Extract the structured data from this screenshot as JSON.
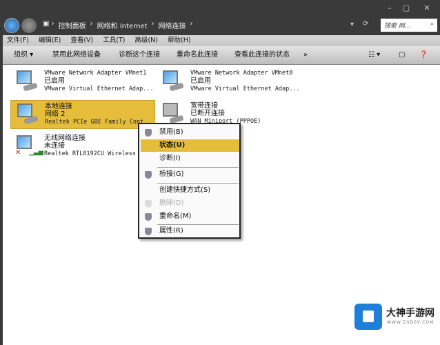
{
  "window": {
    "minimize": "–",
    "maximize": "▢",
    "close": "✕"
  },
  "address": {
    "breadcrumbs": [
      "控制面板",
      "网络和 Internet",
      "网络连接"
    ],
    "search_placeholder": "搜索 网..."
  },
  "menu": [
    "文件(F)",
    "编辑(E)",
    "查看(V)",
    "工具(T)",
    "高级(N)",
    "帮助(H)"
  ],
  "toolbar": {
    "organize": "组织 ▾",
    "disable": "禁用此网络设备",
    "diagnose": "诊断这个连接",
    "rename": "重命名此连接",
    "status": "查看此连接的状态",
    "more": "»"
  },
  "connections": [
    {
      "name": "VMware Network Adapter VMnet1",
      "status": "已启用",
      "device": "VMware Virtual Ethernet Adap..."
    },
    {
      "name": "VMware Network Adapter VMnet8",
      "status": "已启用",
      "device": "VMware Virtual Ethernet Adap..."
    },
    {
      "name": "本地连接",
      "status": "网络  2",
      "device": "Realtek PCIe GBE Family Cont",
      "selected": true
    },
    {
      "name": "宽带连接",
      "status": "已断开连接",
      "device": "WAN Miniport (PPPOE)"
    },
    {
      "name": "无线网络连接",
      "status": "未连接",
      "device": "Realtek RTL8192CU Wireless L"
    }
  ],
  "context_menu": [
    {
      "label": "禁用(B)",
      "icon": "shield-icon"
    },
    {
      "label": "状态(U)",
      "highlighted": true
    },
    {
      "label": "诊断(I)"
    },
    {
      "label": "桥接(G)",
      "icon": "shield-icon"
    },
    {
      "label": "创建快捷方式(S)"
    },
    {
      "label": "删除(D)",
      "disabled": true
    },
    {
      "label": "重命名(M)",
      "icon": "shield-icon"
    },
    {
      "label": "属性(R)",
      "icon": "shield-icon"
    }
  ],
  "watermark": {
    "name": "大神手游网",
    "url": "WWW.DSDSV.COM"
  },
  "colors": {
    "selection": "#e6bd3a",
    "frame": "#3a3a3a"
  }
}
